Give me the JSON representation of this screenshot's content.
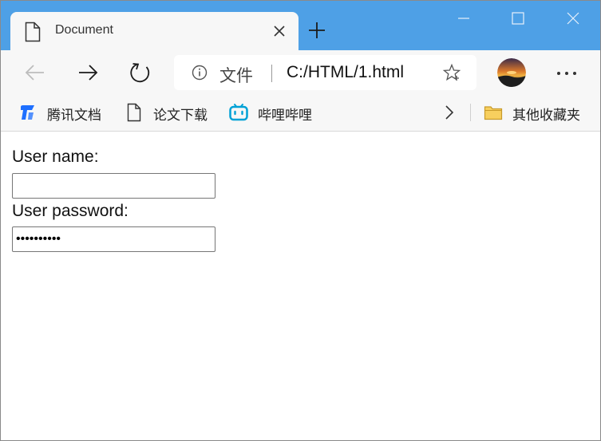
{
  "tab": {
    "title": "Document"
  },
  "address": {
    "scheme_label": "文件",
    "url": "C:/HTML/1.html"
  },
  "favorites": [
    {
      "label": "腾讯文档",
      "icon": "tencent-docs-icon"
    },
    {
      "label": "论文下载",
      "icon": "page-icon"
    },
    {
      "label": "哔哩哔哩",
      "icon": "bilibili-icon"
    },
    {
      "label": "其他收藏夹",
      "icon": "folder-icon"
    }
  ],
  "form": {
    "username_label": "User name:",
    "username_value": "",
    "password_label": "User password:",
    "password_value": "1234567890"
  },
  "colors": {
    "titlebar": "#4ea0e6",
    "toolbar": "#f7f7f7",
    "bilibili": "#00a1d6",
    "tencent": "#1e6fff"
  }
}
